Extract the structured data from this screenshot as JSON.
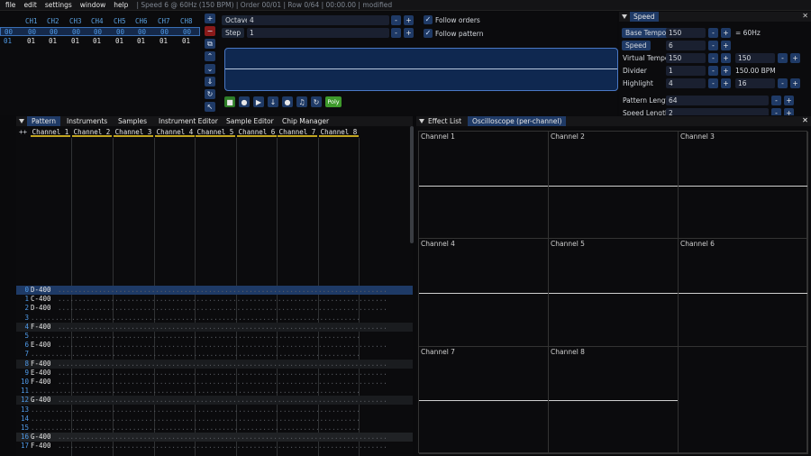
{
  "menu": {
    "items": [
      "file",
      "edit",
      "settings",
      "window",
      "help"
    ],
    "status": "| Speed 6 @ 60Hz (150 BPM) | Order 00/01 | Row 0/64 | 00:00.00  | modified"
  },
  "orders": {
    "headers": [
      "CH1",
      "CH2",
      "CH3",
      "CH4",
      "CH5",
      "CH6",
      "CH7",
      "CH8"
    ],
    "rows": [
      {
        "num": "00",
        "vals": [
          "00",
          "00",
          "00",
          "00",
          "00",
          "00",
          "00",
          "00"
        ]
      },
      {
        "num": "01",
        "vals": [
          "01",
          "01",
          "01",
          "01",
          "01",
          "01",
          "01",
          "01"
        ]
      }
    ]
  },
  "order_tools": [
    "+",
    "−",
    "⧉",
    "⌃",
    "⌄",
    "⇓",
    "↻",
    "↖"
  ],
  "edit": {
    "octave_label": "Octave",
    "octave_value": "4",
    "step_label": "Step",
    "step_value": "1",
    "follow_orders": "Follow orders",
    "follow_pattern": "Follow pattern",
    "poly": "Poly"
  },
  "speed": {
    "title": "Speed",
    "base_tempo_label": "Base Tempo",
    "base_tempo_value": "150",
    "base_tempo_hz": "= 60Hz",
    "speed_label": "Speed",
    "speed_value": "6",
    "virtual_tempo_label": "Virtual Tempo",
    "virtual_tempo_a": "150",
    "virtual_tempo_b": "150",
    "divider_label": "Divider",
    "divider_value": "1",
    "bpm": "150.00 BPM",
    "highlight_label": "Highlight",
    "highlight_a": "4",
    "highlight_b": "16",
    "pattern_length_label": "Pattern Length",
    "pattern_length_value": "64",
    "speed_length_label": "Speed Length",
    "speed_length_value": "2"
  },
  "pattern_tabs": [
    "Pattern",
    "Instruments",
    "Samples",
    "Instrument Editor",
    "Sample Editor",
    "Chip Manager"
  ],
  "pattern_channels": [
    "Channel 1",
    "Channel 2",
    "Channel 3",
    "Channel 4",
    "Channel 5",
    "Channel 6",
    "Channel 7",
    "Channel 8"
  ],
  "pattern_rows": [
    {
      "n": "0",
      "note": "D-400"
    },
    {
      "n": "1",
      "note": "C-400"
    },
    {
      "n": "2",
      "note": "D-400"
    },
    {
      "n": "3",
      "note": ""
    },
    {
      "n": "4",
      "note": "F-400"
    },
    {
      "n": "5",
      "note": ""
    },
    {
      "n": "6",
      "note": "E-400"
    },
    {
      "n": "7",
      "note": ""
    },
    {
      "n": "8",
      "note": "F-400"
    },
    {
      "n": "9",
      "note": "E-400"
    },
    {
      "n": "10",
      "note": "F-400"
    },
    {
      "n": "11",
      "note": ""
    },
    {
      "n": "12",
      "note": "G-400"
    },
    {
      "n": "13",
      "note": ""
    },
    {
      "n": "14",
      "note": ""
    },
    {
      "n": "15",
      "note": ""
    },
    {
      "n": "16",
      "note": "G-400"
    },
    {
      "n": "17",
      "note": "F-400"
    }
  ],
  "right_tabs": [
    "Effect List",
    "Oscilloscope (per-channel)"
  ],
  "scope_channels": [
    "Channel 1",
    "Channel 2",
    "Channel 3",
    "Channel 4",
    "Channel 5",
    "Channel 6",
    "Channel 7",
    "Channel 8"
  ]
}
